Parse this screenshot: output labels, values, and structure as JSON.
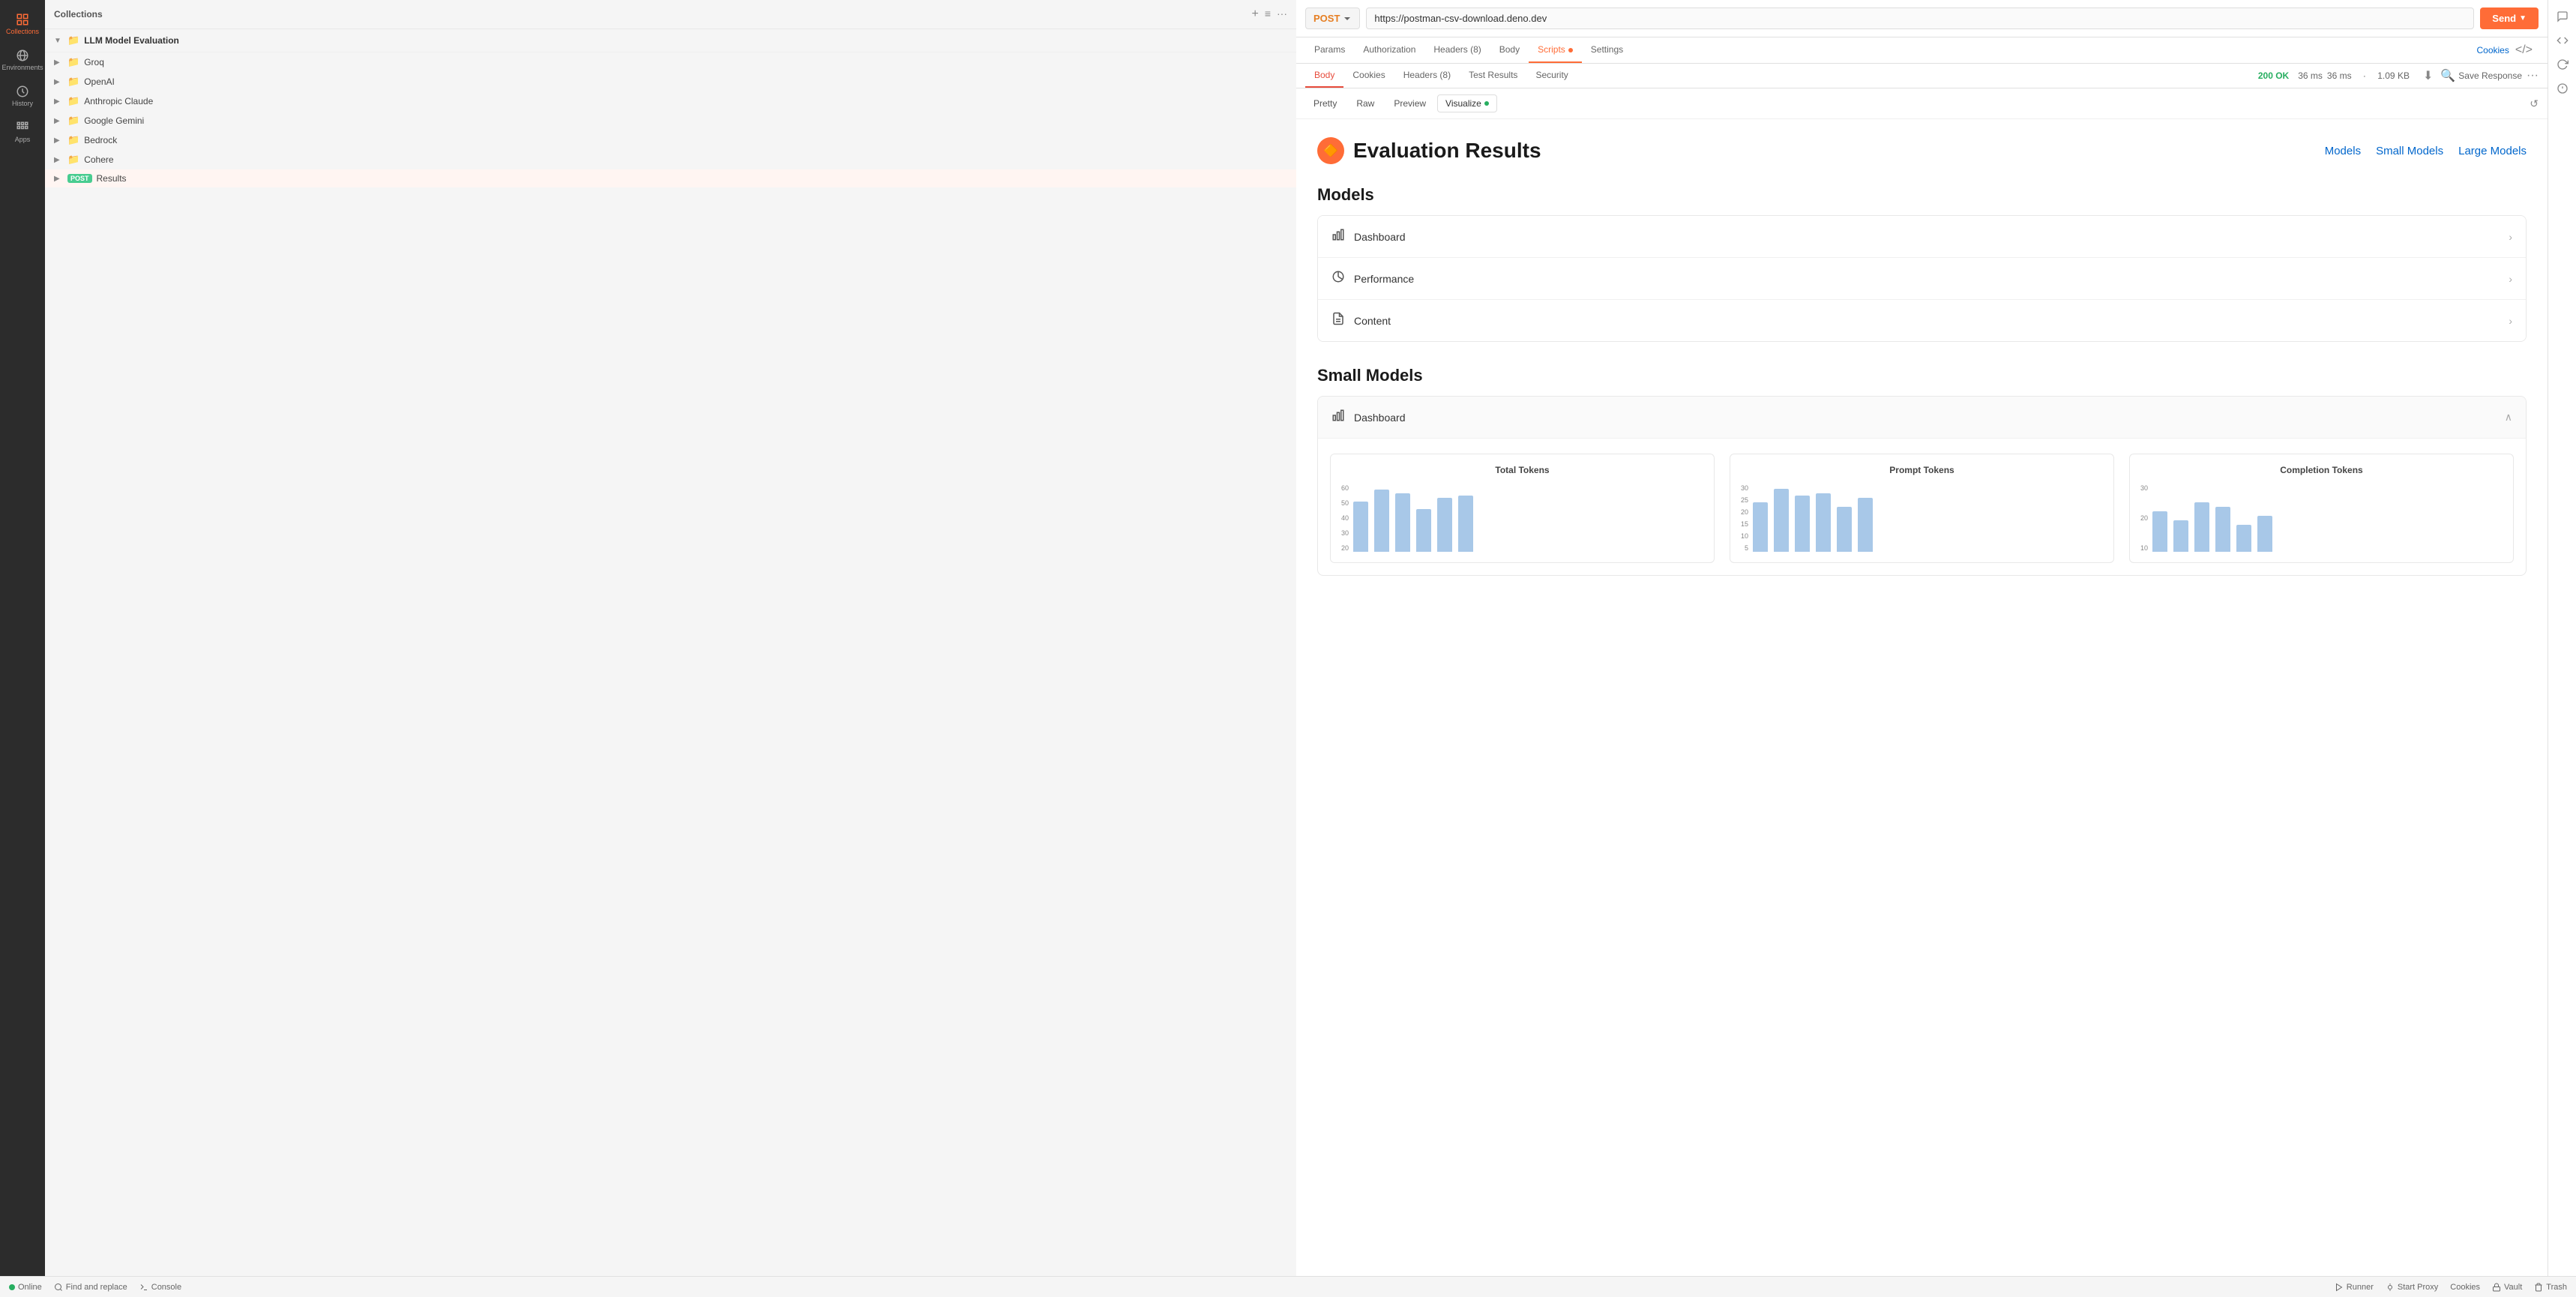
{
  "sidebar": {
    "icons": [
      {
        "id": "collections",
        "label": "Collections",
        "unicode": "☰",
        "active": true
      },
      {
        "id": "environments",
        "label": "Environments",
        "unicode": "🌐",
        "active": false
      },
      {
        "id": "history",
        "label": "History",
        "unicode": "🕐",
        "active": false
      },
      {
        "id": "apps",
        "label": "Apps",
        "unicode": "⚏",
        "active": false
      }
    ],
    "collections_header": {
      "title": "Collections",
      "add_tooltip": "Add",
      "menu_tooltip": "More options"
    },
    "tree": {
      "root_label": "LLM Model Evaluation",
      "items": [
        {
          "label": "Groq",
          "type": "folder",
          "expanded": false
        },
        {
          "label": "OpenAI",
          "type": "folder",
          "expanded": false
        },
        {
          "label": "Anthropic Claude",
          "type": "folder",
          "expanded": false
        },
        {
          "label": "Google Gemini",
          "type": "folder",
          "expanded": false
        },
        {
          "label": "Bedrock",
          "type": "folder",
          "expanded": false
        },
        {
          "label": "Cohere",
          "type": "folder",
          "expanded": false
        },
        {
          "label": "Results",
          "type": "request",
          "method": "POST",
          "active": true
        }
      ]
    }
  },
  "request": {
    "method": "POST",
    "url": "https://postman-csv-download.deno.dev",
    "send_label": "Send"
  },
  "request_tabs": [
    {
      "id": "params",
      "label": "Params",
      "active": false
    },
    {
      "id": "authorization",
      "label": "Authorization",
      "active": false
    },
    {
      "id": "headers",
      "label": "Headers (8)",
      "active": false
    },
    {
      "id": "body",
      "label": "Body",
      "active": false
    },
    {
      "id": "scripts",
      "label": "Scripts",
      "active": true,
      "dot": true
    },
    {
      "id": "settings",
      "label": "Settings",
      "active": false
    }
  ],
  "cookies_link": "Cookies",
  "response_tabs": [
    {
      "id": "body",
      "label": "Body",
      "active": true
    },
    {
      "id": "cookies",
      "label": "Cookies",
      "active": false
    },
    {
      "id": "headers",
      "label": "Headers (8)",
      "active": false
    },
    {
      "id": "test-results",
      "label": "Test Results",
      "active": false
    },
    {
      "id": "security",
      "label": "Security",
      "active": false
    }
  ],
  "response_meta": {
    "status": "200 OK",
    "time": "36 ms",
    "size": "1.09 KB",
    "save_label": "Save Response"
  },
  "view_tabs": [
    {
      "id": "pretty",
      "label": "Pretty",
      "active": false
    },
    {
      "id": "raw",
      "label": "Raw",
      "active": false
    },
    {
      "id": "preview",
      "label": "Preview",
      "active": false
    },
    {
      "id": "visualize",
      "label": "Visualize",
      "active": true,
      "dot": true
    }
  ],
  "visualization": {
    "title": "Evaluation Results",
    "nav_links": [
      "Models",
      "Small Models",
      "Large Models"
    ],
    "sections": [
      {
        "id": "models",
        "title": "Models",
        "items": [
          {
            "id": "dashboard",
            "label": "Dashboard",
            "icon": "bar-chart"
          },
          {
            "id": "performance",
            "label": "Performance",
            "icon": "pie-chart"
          },
          {
            "id": "content",
            "label": "Content",
            "icon": "file"
          }
        ]
      },
      {
        "id": "small-models",
        "title": "Small Models",
        "dashboard_expanded": true,
        "dashboard_label": "Dashboard",
        "charts": [
          {
            "title": "Total Tokens",
            "y_labels": [
              "60",
              "50",
              "40",
              "30",
              "20"
            ],
            "bars": [
              45,
              55,
              52,
              38,
              48,
              50
            ]
          },
          {
            "title": "Prompt Tokens",
            "y_labels": [
              "30",
              "25",
              "20",
              "15",
              "10",
              "5"
            ],
            "bars": [
              22,
              28,
              25,
              26,
              20,
              24
            ]
          },
          {
            "title": "Completion Tokens",
            "y_labels": [
              "30",
              "20",
              "10"
            ],
            "bars": [
              18,
              14,
              22,
              20,
              12,
              16
            ]
          }
        ]
      }
    ]
  },
  "bottom_bar": {
    "online_label": "Online",
    "find_replace_label": "Find and replace",
    "console_label": "Console",
    "runner_label": "Runner",
    "start_proxy_label": "Start Proxy",
    "cookies_label": "Cookies",
    "vault_label": "Vault",
    "trash_label": "Trash"
  }
}
